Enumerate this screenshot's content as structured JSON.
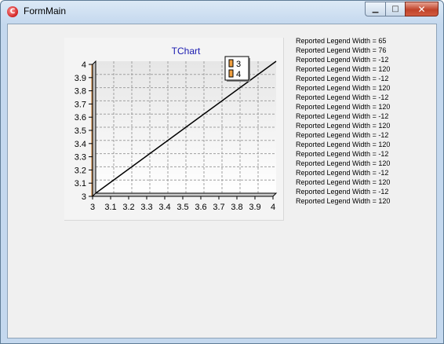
{
  "window": {
    "title": "FormMain",
    "minimize_glyph": "▁",
    "maximize_glyph": "□",
    "close_glyph": "✕"
  },
  "chart_data": {
    "type": "line",
    "title": "TChart",
    "xlim": [
      3,
      4
    ],
    "ylim": [
      3,
      4
    ],
    "x_ticks": [
      "3",
      "3.1",
      "3.2",
      "3.3",
      "3.4",
      "3.5",
      "3.6",
      "3.7",
      "3.8",
      "3.9",
      "4"
    ],
    "y_ticks": [
      "3",
      "3.1",
      "3.2",
      "3.3",
      "3.4",
      "3.5",
      "3.6",
      "3.7",
      "3.8",
      "3.9",
      "4"
    ],
    "grid": true,
    "legend_position": "top-right",
    "legend": [
      "3",
      "4"
    ],
    "series": [
      {
        "x": [
          3,
          4
        ],
        "y": [
          3,
          4
        ]
      }
    ],
    "colors": {
      "line": "#000000",
      "legend_swatch": "#f0a040",
      "title": "#1a1ab0",
      "grid": "#a0a0a0"
    }
  },
  "log": {
    "lines": [
      "Reported Legend Width = 65",
      "Reported Legend Width = 76",
      "Reported Legend Width = -12",
      "Reported Legend Width = 120",
      "Reported Legend Width = -12",
      "Reported Legend Width = 120",
      "Reported Legend Width = -12",
      "Reported Legend Width = 120",
      "Reported Legend Width = -12",
      "Reported Legend Width = 120",
      "Reported Legend Width = -12",
      "Reported Legend Width = 120",
      "Reported Legend Width = -12",
      "Reported Legend Width = 120",
      "Reported Legend Width = -12",
      "Reported Legend Width = 120",
      "Reported Legend Width = -12",
      "Reported Legend Width = 120"
    ]
  }
}
